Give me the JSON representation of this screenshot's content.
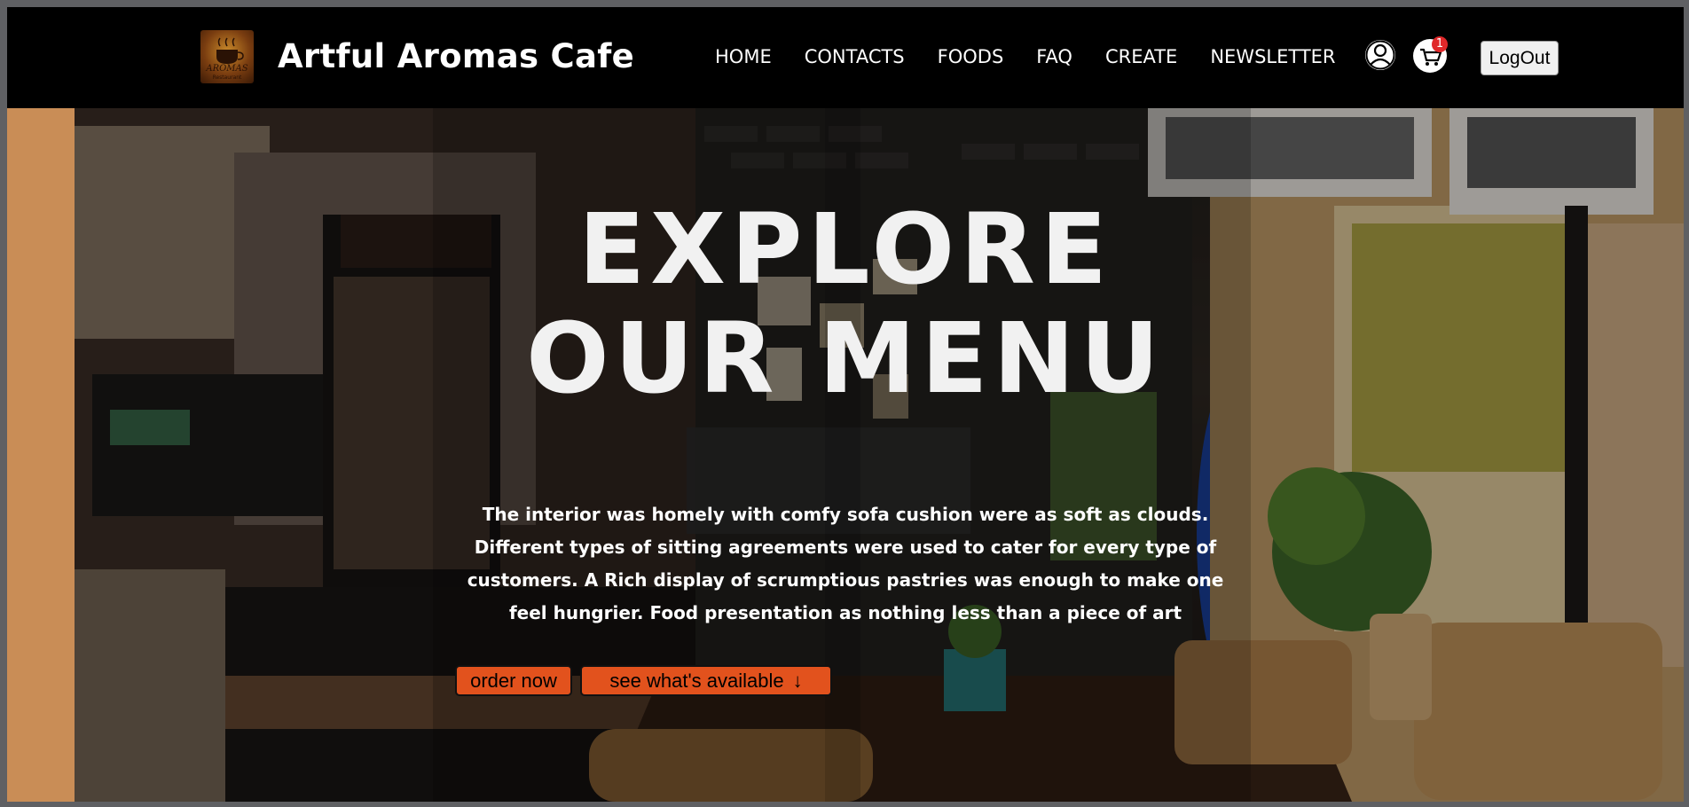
{
  "navbar": {
    "brand": "Artful Aromas Cafe",
    "logo_text": "AROMAS",
    "logo_subtext": "Restaurant",
    "links": [
      "HOME",
      "CONTACTS",
      "FOODS",
      "FAQ",
      "CREATE",
      "NEWSLETTER"
    ],
    "cart_count": "1",
    "logout_label": "LogOut"
  },
  "hero": {
    "title_line1": "EXPLORE",
    "title_line2": "OUR MENU",
    "description": "The interior was homely with comfy sofa cushion were as soft as clouds. Different types of sitting agreements were used to cater for every type of customers. A Rich display of scrumptious pastries was enough to make one feel hungrier. Food presentation as nothing less than a piece of art",
    "order_button": "order now",
    "available_button": "see what's available",
    "arrow_icon": "↓"
  },
  "colors": {
    "navbar_bg": "#000000",
    "accent": "#e2521d",
    "left_strip": "#c98d56"
  }
}
